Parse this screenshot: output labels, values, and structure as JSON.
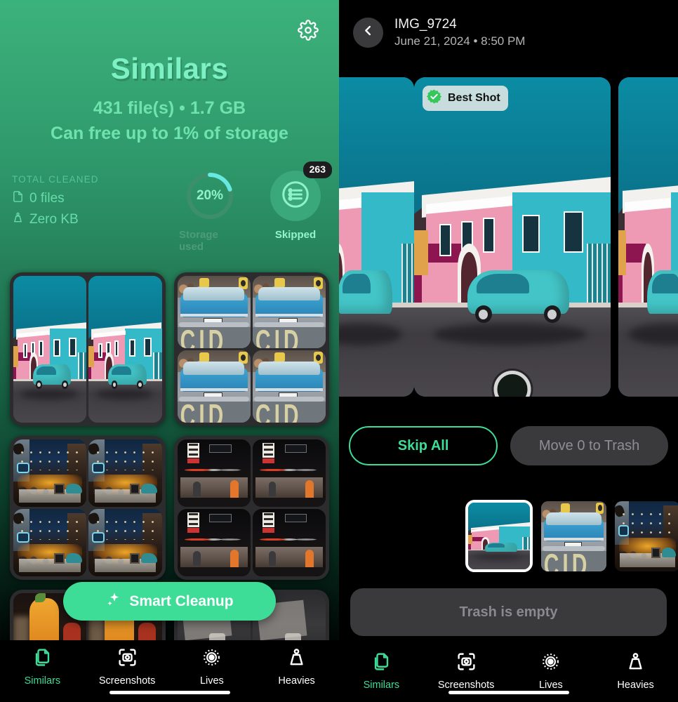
{
  "left": {
    "gear_icon": "gear-icon",
    "title": "Similars",
    "stats_line_1": "431 file(s) • 1.7 GB",
    "stats_line_2": "Can free up to 1% of storage",
    "total_cleaned": {
      "label": "TOTAL CLEANED",
      "files": "0 files",
      "size": "Zero KB",
      "files_icon": "file-icon",
      "size_icon": "weight-icon"
    },
    "stats": [
      {
        "value": "20%",
        "caption": "Storage used",
        "kind": "ring",
        "percent": 20
      },
      {
        "value": "263",
        "caption": "Skipped",
        "kind": "badge",
        "icon": "list-icon"
      }
    ],
    "smart_cleanup": {
      "label": "Smart Cleanup",
      "icon": "sparkles-icon"
    }
  },
  "right": {
    "back_icon": "chevron-left-icon",
    "photo_name": "IMG_9724",
    "photo_meta": "June 21, 2024 • 8:50 PM",
    "best_shot_badge": {
      "label": "Best Shot",
      "icon": "verified-check-icon"
    },
    "skip_all": "Skip All",
    "move_to_trash": "Move 0 to Trash",
    "trash_status": "Trash is empty"
  },
  "tabbar": {
    "items": [
      {
        "label": "Similars",
        "icon": "documents-copy-icon",
        "active": true
      },
      {
        "label": "Screenshots",
        "icon": "screenshot-frame-icon",
        "active": false
      },
      {
        "label": "Lives",
        "icon": "live-photo-icon",
        "active": false
      },
      {
        "label": "Heavies",
        "icon": "weight-icon",
        "active": false
      }
    ]
  },
  "colors": {
    "accent_green": "#3ddc97",
    "mint_title": "#7df0c4",
    "ring_track": "#3d8f6c",
    "ring_fill": "#67e8e0",
    "dark_surface": "#3a3a3c",
    "muted_text": "#8e8e93"
  }
}
